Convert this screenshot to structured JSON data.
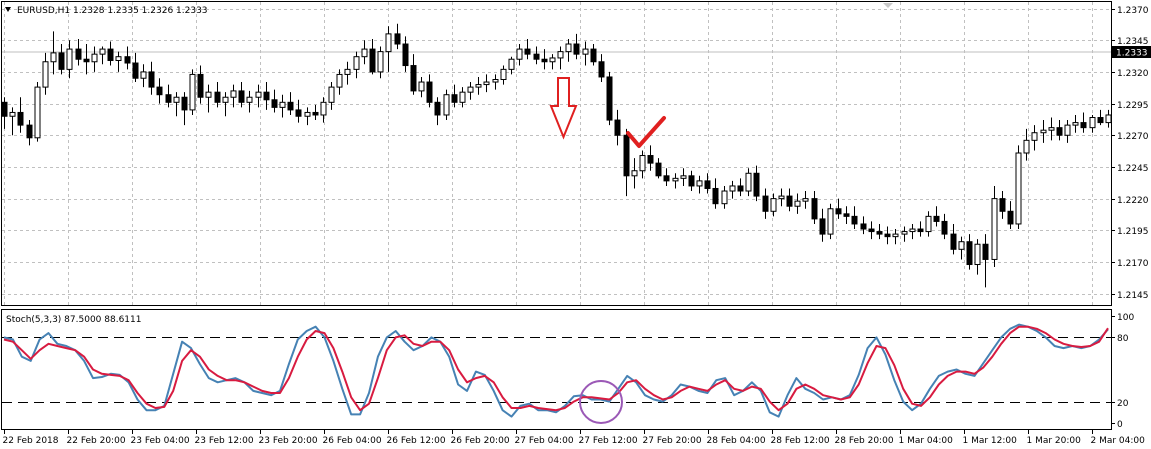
{
  "chart_data": [
    {
      "type": "candlestick",
      "title": "EURUSD,H1  1.2328 1.2335 1.2326 1.2333",
      "yticks": [
        "1.2370",
        "1.2345",
        "1.2320",
        "1.2295",
        "1.2270",
        "1.2245",
        "1.2220",
        "1.2195",
        "1.2170",
        "1.2145"
      ],
      "ylim": [
        1.214,
        1.2372
      ],
      "current_price": "1.2333",
      "grid": true,
      "colors": {
        "bull": "#ffffff",
        "bear": "#000000",
        "outline": "#000000",
        "arrow": "#e02020",
        "check": "#e02020"
      },
      "annotations": [
        "down-arrow",
        "check-mark"
      ],
      "candles": [
        [
          1.2296,
          1.23,
          1.2275,
          1.2285
        ],
        [
          1.2285,
          1.2292,
          1.227,
          1.2288
        ],
        [
          1.2288,
          1.23,
          1.2272,
          1.2278
        ],
        [
          1.2278,
          1.2282,
          1.2262,
          1.2268
        ],
        [
          1.2268,
          1.2312,
          1.2265,
          1.2308
        ],
        [
          1.2308,
          1.2335,
          1.2302,
          1.2328
        ],
        [
          1.2328,
          1.2352,
          1.2318,
          1.2335
        ],
        [
          1.2335,
          1.2342,
          1.2318,
          1.2322
        ],
        [
          1.2322,
          1.2345,
          1.2315,
          1.2338
        ],
        [
          1.2338,
          1.2346,
          1.2325,
          1.233
        ],
        [
          1.233,
          1.2342,
          1.2318,
          1.2328
        ],
        [
          1.2328,
          1.234,
          1.232,
          1.2334
        ],
        [
          1.2334,
          1.234,
          1.2326,
          1.2338
        ],
        [
          1.2338,
          1.2344,
          1.2325,
          1.2329
        ],
        [
          1.2329,
          1.2336,
          1.232,
          1.2332
        ],
        [
          1.2332,
          1.234,
          1.2322,
          1.2327
        ],
        [
          1.2327,
          1.2335,
          1.2312,
          1.2315
        ],
        [
          1.2315,
          1.2326,
          1.2308,
          1.232
        ],
        [
          1.232,
          1.2328,
          1.2302,
          1.2308
        ],
        [
          1.2308,
          1.2315,
          1.2295,
          1.2302
        ],
        [
          1.2302,
          1.231,
          1.2292,
          1.2296
        ],
        [
          1.2296,
          1.2304,
          1.2285,
          1.23
        ],
        [
          1.23,
          1.2304,
          1.2278,
          1.229
        ],
        [
          1.229,
          1.2322,
          1.2286,
          1.2318
        ],
        [
          1.2318,
          1.2325,
          1.2295,
          1.23
        ],
        [
          1.23,
          1.231,
          1.2288,
          1.2304
        ],
        [
          1.2304,
          1.2312,
          1.2292,
          1.2296
        ],
        [
          1.2296,
          1.2304,
          1.2285,
          1.23
        ],
        [
          1.23,
          1.231,
          1.2292,
          1.2305
        ],
        [
          1.2305,
          1.2312,
          1.2292,
          1.2296
        ],
        [
          1.2296,
          1.2305,
          1.2288,
          1.23
        ],
        [
          1.23,
          1.231,
          1.2292,
          1.2304
        ],
        [
          1.2304,
          1.2312,
          1.229,
          1.2298
        ],
        [
          1.2298,
          1.2306,
          1.2288,
          1.2292
        ],
        [
          1.2292,
          1.2302,
          1.2284,
          1.2296
        ],
        [
          1.2296,
          1.2304,
          1.2286,
          1.229
        ],
        [
          1.229,
          1.2298,
          1.228,
          1.2285
        ],
        [
          1.2285,
          1.2292,
          1.2278,
          1.2288
        ],
        [
          1.2288,
          1.2294,
          1.2282,
          1.2286
        ],
        [
          1.2286,
          1.23,
          1.228,
          1.2296
        ],
        [
          1.2296,
          1.2312,
          1.229,
          1.2308
        ],
        [
          1.2308,
          1.2322,
          1.2302,
          1.2318
        ],
        [
          1.2318,
          1.2328,
          1.231,
          1.2322
        ],
        [
          1.2322,
          1.2336,
          1.2315,
          1.2332
        ],
        [
          1.2332,
          1.2345,
          1.2326,
          1.2338
        ],
        [
          1.2338,
          1.2346,
          1.2318,
          1.232
        ],
        [
          1.232,
          1.234,
          1.2315,
          1.2336
        ],
        [
          1.2336,
          1.2356,
          1.232,
          1.235
        ],
        [
          1.235,
          1.2358,
          1.2338,
          1.2342
        ],
        [
          1.2342,
          1.2348,
          1.232,
          1.2325
        ],
        [
          1.2325,
          1.2334,
          1.2302,
          1.2305
        ],
        [
          1.2305,
          1.2316,
          1.23,
          1.2312
        ],
        [
          1.2312,
          1.2318,
          1.2292,
          1.2296
        ],
        [
          1.2296,
          1.23,
          1.2278,
          1.2286
        ],
        [
          1.2286,
          1.2306,
          1.2282,
          1.2302
        ],
        [
          1.2302,
          1.231,
          1.2292,
          1.2296
        ],
        [
          1.2296,
          1.2308,
          1.2292,
          1.2304
        ],
        [
          1.2304,
          1.2312,
          1.2298,
          1.2308
        ],
        [
          1.2308,
          1.2316,
          1.2302,
          1.231
        ],
        [
          1.231,
          1.2318,
          1.2304,
          1.2312
        ],
        [
          1.2312,
          1.2318,
          1.2306,
          1.2314
        ],
        [
          1.2314,
          1.2325,
          1.231,
          1.2322
        ],
        [
          1.2322,
          1.2332,
          1.2318,
          1.233
        ],
        [
          1.233,
          1.2342,
          1.2325,
          1.2338
        ],
        [
          1.2338,
          1.2346,
          1.233,
          1.2334
        ],
        [
          1.2334,
          1.234,
          1.2326,
          1.233
        ],
        [
          1.233,
          1.2338,
          1.2322,
          1.2328
        ],
        [
          1.2328,
          1.2334,
          1.2322,
          1.2331
        ],
        [
          1.2331,
          1.234,
          1.2322,
          1.2336
        ],
        [
          1.2336,
          1.2346,
          1.2328,
          1.2342
        ],
        [
          1.2342,
          1.235,
          1.233,
          1.2334
        ],
        [
          1.2334,
          1.2344,
          1.2325,
          1.2338
        ],
        [
          1.2338,
          1.2342,
          1.2325,
          1.2328
        ],
        [
          1.2328,
          1.2334,
          1.2312,
          1.2316
        ],
        [
          1.2316,
          1.232,
          1.2278,
          1.2282
        ],
        [
          1.2282,
          1.229,
          1.2262,
          1.227
        ],
        [
          1.227,
          1.2275,
          1.2222,
          1.2238
        ],
        [
          1.2238,
          1.2252,
          1.2228,
          1.2242
        ],
        [
          1.2242,
          1.2258,
          1.2236,
          1.2254
        ],
        [
          1.2254,
          1.2262,
          1.2242,
          1.2248
        ],
        [
          1.2248,
          1.2252,
          1.2236,
          1.2238
        ],
        [
          1.2238,
          1.2244,
          1.223,
          1.2234
        ],
        [
          1.2234,
          1.224,
          1.2228,
          1.2236
        ],
        [
          1.2236,
          1.2244,
          1.223,
          1.2238
        ],
        [
          1.2238,
          1.2242,
          1.2226,
          1.223
        ],
        [
          1.223,
          1.2238,
          1.2224,
          1.2234
        ],
        [
          1.2234,
          1.224,
          1.2224,
          1.2228
        ],
        [
          1.2228,
          1.2236,
          1.2212,
          1.2216
        ],
        [
          1.2216,
          1.223,
          1.2212,
          1.2226
        ],
        [
          1.2226,
          1.2234,
          1.222,
          1.223
        ],
        [
          1.223,
          1.2236,
          1.2222,
          1.2226
        ],
        [
          1.2226,
          1.2244,
          1.2222,
          1.224
        ],
        [
          1.224,
          1.2246,
          1.2218,
          1.2222
        ],
        [
          1.2222,
          1.2228,
          1.2204,
          1.221
        ],
        [
          1.221,
          1.2224,
          1.2206,
          1.222
        ],
        [
          1.222,
          1.2228,
          1.2214,
          1.2222
        ],
        [
          1.2222,
          1.2228,
          1.221,
          1.2214
        ],
        [
          1.2214,
          1.2224,
          1.2208,
          1.2218
        ],
        [
          1.2218,
          1.2226,
          1.2212,
          1.222
        ],
        [
          1.222,
          1.2226,
          1.22,
          1.2204
        ],
        [
          1.2204,
          1.2212,
          1.2186,
          1.2192
        ],
        [
          1.2192,
          1.2216,
          1.2188,
          1.2212
        ],
        [
          1.2212,
          1.222,
          1.2204,
          1.2208
        ],
        [
          1.2208,
          1.2214,
          1.22,
          1.2206
        ],
        [
          1.2206,
          1.2214,
          1.2196,
          1.22
        ],
        [
          1.22,
          1.2206,
          1.2192,
          1.2196
        ],
        [
          1.2196,
          1.2202,
          1.2188,
          1.2194
        ],
        [
          1.2194,
          1.22,
          1.2188,
          1.2192
        ],
        [
          1.2192,
          1.2198,
          1.2184,
          1.219
        ],
        [
          1.219,
          1.2196,
          1.2184,
          1.2192
        ],
        [
          1.2192,
          1.2198,
          1.2186,
          1.2194
        ],
        [
          1.2194,
          1.22,
          1.2188,
          1.2196
        ],
        [
          1.2196,
          1.2202,
          1.219,
          1.2194
        ],
        [
          1.2194,
          1.221,
          1.219,
          1.2206
        ],
        [
          1.2206,
          1.2214,
          1.2198,
          1.2202
        ],
        [
          1.2202,
          1.2208,
          1.2188,
          1.2192
        ],
        [
          1.2192,
          1.22,
          1.2176,
          1.218
        ],
        [
          1.218,
          1.219,
          1.2172,
          1.2186
        ],
        [
          1.2186,
          1.2192,
          1.2164,
          1.2168
        ],
        [
          1.2168,
          1.2188,
          1.216,
          1.2184
        ],
        [
          1.2184,
          1.2192,
          1.215,
          1.2172
        ],
        [
          1.2172,
          1.223,
          1.2166,
          1.222
        ],
        [
          1.222,
          1.2226,
          1.2204,
          1.221
        ],
        [
          1.221,
          1.2218,
          1.2196,
          1.22
        ],
        [
          1.22,
          1.2262,
          1.2196,
          1.2256
        ],
        [
          1.2256,
          1.2275,
          1.225,
          1.2266
        ],
        [
          1.2266,
          1.2278,
          1.2258,
          1.2272
        ],
        [
          1.2272,
          1.2282,
          1.2264,
          1.2274
        ],
        [
          1.2274,
          1.2284,
          1.2266,
          1.2276
        ],
        [
          1.2276,
          1.2282,
          1.2266,
          1.227
        ],
        [
          1.227,
          1.2282,
          1.2264,
          1.2278
        ],
        [
          1.2278,
          1.2286,
          1.2272,
          1.228
        ],
        [
          1.228,
          1.2288,
          1.2272,
          1.2276
        ],
        [
          1.2276,
          1.2286,
          1.2272,
          1.2284
        ],
        [
          1.2284,
          1.229,
          1.2278,
          1.228
        ],
        [
          1.228,
          1.229,
          1.2276,
          1.2286
        ]
      ]
    },
    {
      "type": "line",
      "title": "Stoch(5,3,3) 87.5000 88.6111",
      "yticks": [
        "100",
        "80",
        "20",
        "0"
      ],
      "ylim": [
        0,
        100
      ],
      "levels": [
        80,
        20
      ],
      "colors": {
        "main": "#4682b4",
        "signal": "#d81b40",
        "level": "#000000",
        "highlight_circle": "#9b59b6"
      },
      "annotations": [
        "highlight-circle"
      ],
      "series": [
        {
          "values": [
            80,
            78,
            62,
            58,
            78,
            84,
            74,
            72,
            68,
            58,
            42,
            43,
            46,
            45,
            38,
            22,
            12,
            12,
            16,
            46,
            76,
            70,
            55,
            42,
            38,
            40,
            42,
            38,
            30,
            28,
            26,
            30,
            55,
            78,
            86,
            90,
            80,
            58,
            32,
            8,
            8,
            28,
            62,
            80,
            86,
            76,
            68,
            72,
            80,
            76,
            62,
            36,
            30,
            48,
            45,
            30,
            12,
            6,
            16,
            18,
            12,
            12,
            10,
            16,
            25,
            26,
            22,
            22,
            20,
            32,
            44,
            38,
            26,
            22,
            20,
            26,
            36,
            34,
            30,
            28,
            40,
            42,
            26,
            30,
            38,
            30,
            10,
            6,
            26,
            42,
            32,
            28,
            22,
            24,
            22,
            26,
            45,
            70,
            80,
            64,
            40,
            20,
            12,
            18,
            32,
            44,
            48,
            50,
            46,
            44,
            56,
            68,
            80,
            88,
            92,
            90,
            86,
            80,
            72,
            70,
            72,
            70,
            72,
            78,
            87.5
          ]
        },
        {
          "values": [
            78,
            76,
            68,
            60,
            68,
            74,
            72,
            70,
            68,
            62,
            50,
            46,
            45,
            44,
            40,
            28,
            18,
            14,
            15,
            30,
            58,
            68,
            62,
            50,
            44,
            40,
            40,
            38,
            34,
            30,
            28,
            28,
            42,
            62,
            78,
            86,
            84,
            70,
            48,
            24,
            12,
            18,
            42,
            68,
            80,
            82,
            74,
            72,
            76,
            76,
            68,
            50,
            38,
            42,
            44,
            38,
            24,
            14,
            14,
            16,
            14,
            13,
            12,
            14,
            20,
            24,
            24,
            23,
            22,
            28,
            38,
            40,
            32,
            26,
            22,
            24,
            30,
            34,
            32,
            30,
            36,
            40,
            32,
            30,
            34,
            32,
            20,
            12,
            18,
            32,
            36,
            32,
            26,
            24,
            22,
            24,
            36,
            56,
            72,
            70,
            54,
            32,
            18,
            16,
            24,
            36,
            44,
            48,
            48,
            46,
            52,
            62,
            74,
            84,
            90,
            90,
            88,
            84,
            78,
            74,
            72,
            71,
            72,
            76,
            88.6111
          ]
        }
      ]
    }
  ],
  "time_labels": [
    "22 Feb 2018",
    "22 Feb 20:00",
    "23 Feb 04:00",
    "23 Feb 12:00",
    "23 Feb 20:00",
    "26 Feb 04:00",
    "26 Feb 12:00",
    "26 Feb 20:00",
    "27 Feb 04:00",
    "27 Feb 12:00",
    "27 Feb 20:00",
    "28 Feb 04:00",
    "28 Feb 12:00",
    "28 Feb 20:00",
    "1 Mar 04:00",
    "1 Mar 12:00",
    "1 Mar 20:00",
    "2 Mar 04:00"
  ]
}
